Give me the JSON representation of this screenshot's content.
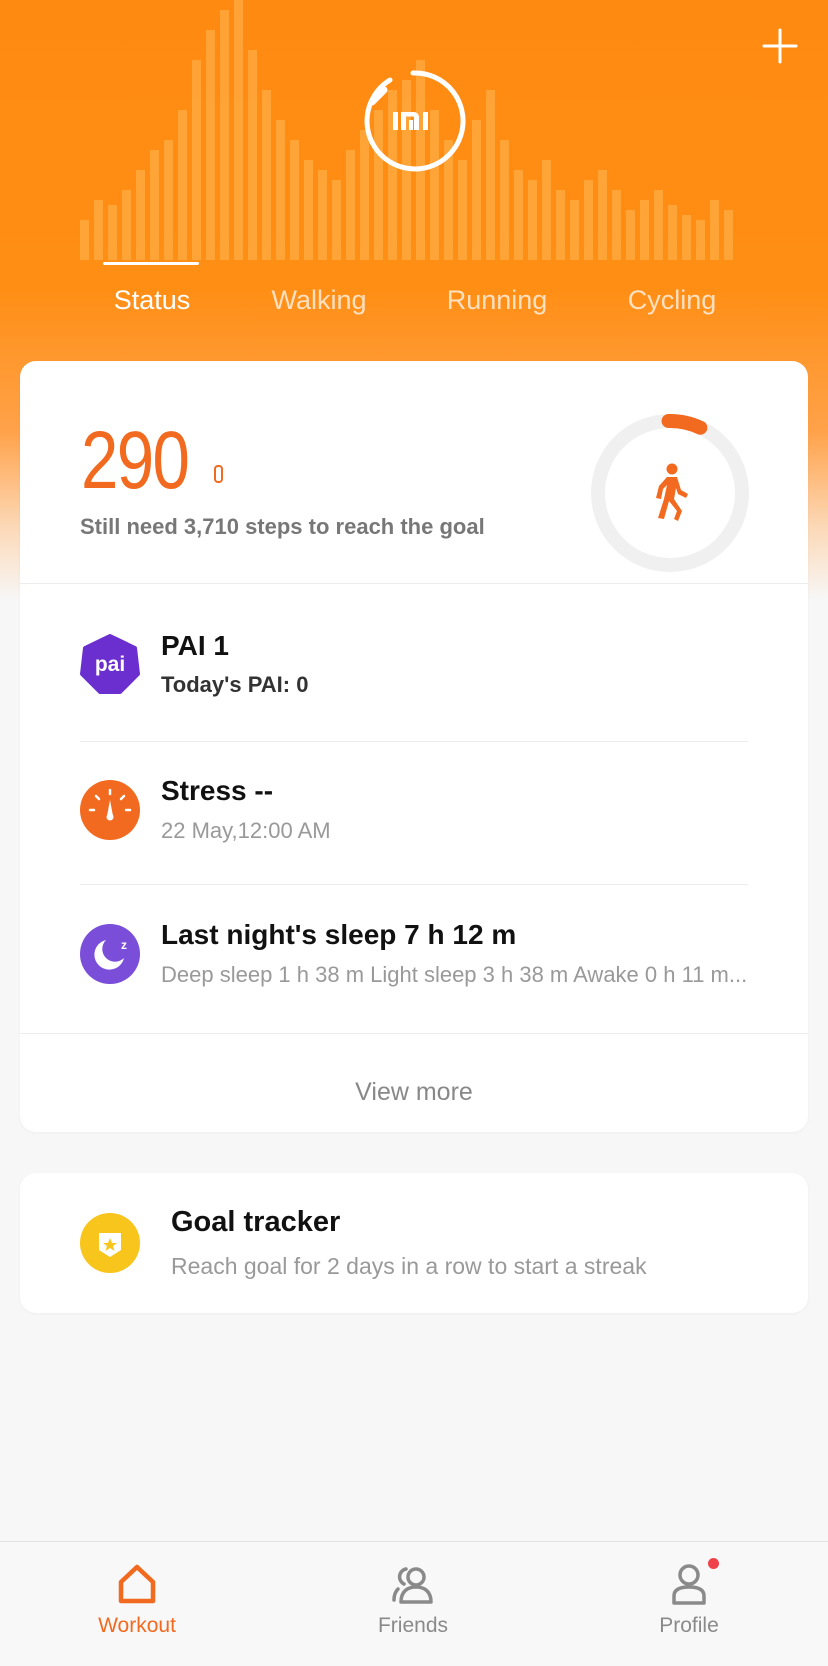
{
  "header": {
    "brand_logo": "mi-logo",
    "add_icon": "plus-icon",
    "tabs": [
      {
        "label": "Status",
        "active": true
      },
      {
        "label": "Walking",
        "active": false
      },
      {
        "label": "Running",
        "active": false
      },
      {
        "label": "Cycling",
        "active": false
      }
    ]
  },
  "steps": {
    "count": "290",
    "subtitle": "Still need 3,710 steps to reach the goal",
    "goal_progress": 0.0725,
    "icon": "walking-person-icon",
    "accent_color": "#f26a1f"
  },
  "rows": {
    "pai": {
      "title": "PAI 1",
      "subtitle": "Today's PAI: 0",
      "icon_text": "pai",
      "icon_color": "#6b2fd0"
    },
    "stress": {
      "title": "Stress --",
      "subtitle": "22 May,12:00 AM",
      "icon": "gauge-icon",
      "icon_color": "#f26a1f"
    },
    "sleep": {
      "title": "Last night's sleep 7 h 12 m",
      "subtitle": "Deep sleep 1 h 38 m  Light sleep 3 h 38 m  Awake 0 h 11 m...",
      "icon": "moon-icon",
      "icon_color": "#7a4ed9"
    }
  },
  "view_more": "View more",
  "goal_tracker": {
    "title": "Goal tracker",
    "subtitle": "Reach goal for 2 days in a row to start a streak",
    "icon": "badge-star-icon",
    "icon_color": "#f8c51c"
  },
  "bottom_nav": [
    {
      "label": "Workout",
      "icon": "home-icon",
      "active": true
    },
    {
      "label": "Friends",
      "icon": "friends-icon",
      "active": false
    },
    {
      "label": "Profile",
      "icon": "profile-icon",
      "active": false,
      "badge": true
    }
  ]
}
